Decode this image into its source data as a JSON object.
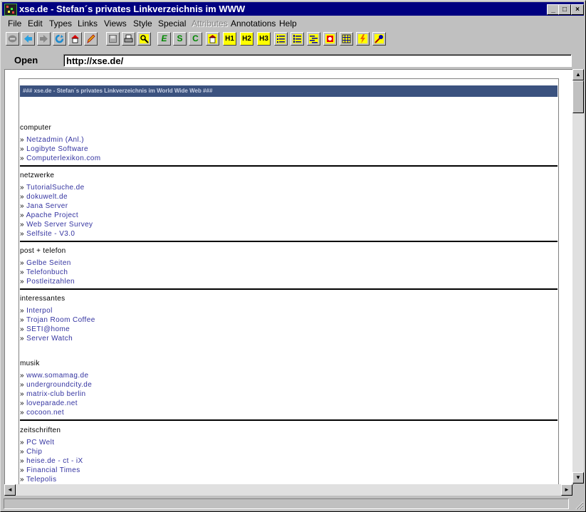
{
  "window": {
    "title": "xse.de - Stefan´s privates Linkverzeichnis im WWW",
    "controls": {
      "minimize": "_",
      "maximize": "□",
      "close": "×"
    }
  },
  "menu": [
    "File",
    "Edit",
    "Types",
    "Links",
    "Views",
    "Style",
    "Special",
    "Attributes",
    "Annotations",
    "Help"
  ],
  "menu_disabled": [
    "Attributes"
  ],
  "toolbar": {
    "icons": [
      "stop-icon",
      "back-icon",
      "forward-icon",
      "reload-icon",
      "home-icon",
      "edit-icon",
      "save-icon",
      "print-icon",
      "find-icon",
      "emphasis-icon",
      "strong-icon",
      "code-icon",
      "address-icon",
      "h1-icon",
      "h2-icon",
      "h3-icon",
      "bullet-list-icon",
      "numbered-list-icon",
      "definition-list-icon",
      "image-icon",
      "table-icon",
      "link-icon",
      "annotate-icon"
    ],
    "glyphs": {
      "emphasis": "E",
      "strong": "S",
      "code": "C",
      "h1": "H1",
      "h2": "H2",
      "h3": "H3"
    }
  },
  "address": {
    "label": "Open",
    "value": "http://xse.de/"
  },
  "page": {
    "banner": "### xse.de - Stefan´s privates Linkverzeichnis im World Wide Web ###",
    "bullet": "» ",
    "sections": [
      {
        "title": "computer",
        "links": [
          "Netzadmin (Anl.)",
          "Logibyte Software",
          "Computerlexikon.com"
        ]
      },
      {
        "title": "netzwerke",
        "links": [
          "TutorialSuche.de",
          "dokuwelt.de",
          "Jana Server",
          "Apache Project",
          "Web Server Survey",
          "Selfsite - V3.0"
        ]
      },
      {
        "title": "post + telefon",
        "links": [
          "Gelbe Seiten",
          "Telefonbuch",
          "Postleitzahlen"
        ]
      },
      {
        "title": "interessantes",
        "links": [
          "Interpol",
          "Trojan Room Coffee",
          "SETI@home",
          "Server Watch"
        ]
      },
      {
        "title": "musik",
        "links": [
          "www.somamag.de",
          "undergroundcity.de",
          "matrix-club berlin",
          "loveparade.net",
          "cocoon.net"
        ]
      },
      {
        "title": "zeitschriften",
        "links": [
          "PC Welt",
          "Chip",
          "heise.de - ct - iX",
          "Financial Times",
          "Telepolis"
        ]
      }
    ]
  },
  "scroll": {
    "up": "▲",
    "down": "▼",
    "left": "◄",
    "right": "►"
  },
  "colors": {
    "titlebar": "#000080",
    "banner": "#3b527f",
    "link": "#3333a0"
  }
}
